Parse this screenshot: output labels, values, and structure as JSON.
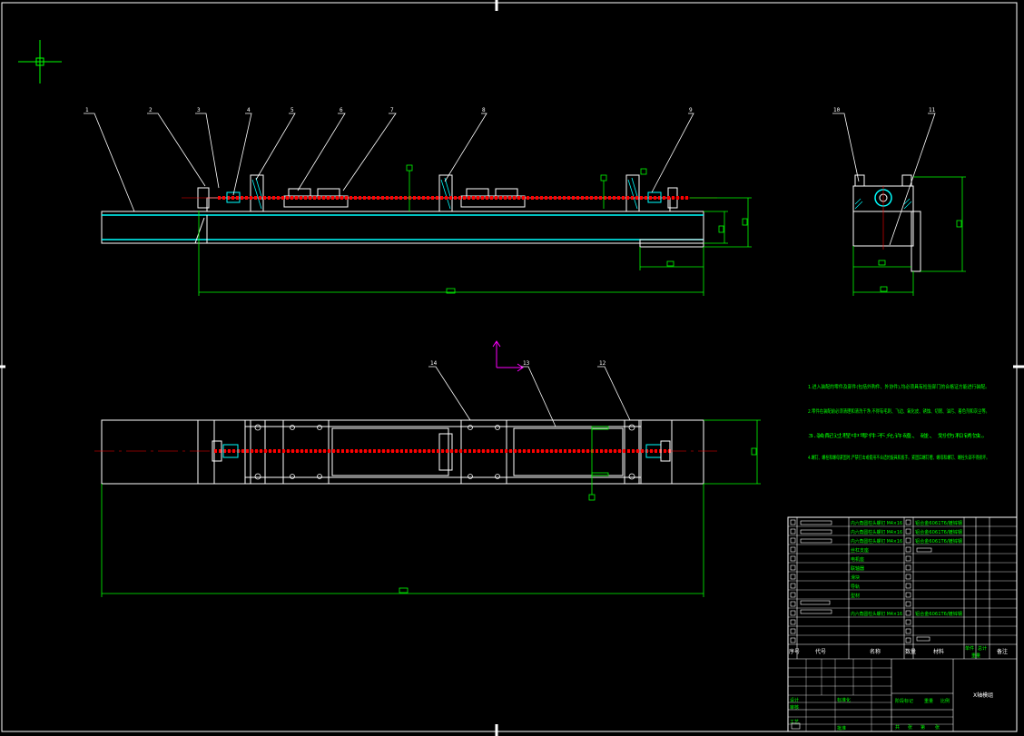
{
  "drawing": {
    "part_callouts": [
      "1",
      "2",
      "3",
      "4",
      "5",
      "6",
      "7",
      "8",
      "9",
      "10",
      "11",
      "12",
      "13",
      "14"
    ],
    "tech_notes": [
      "1.进入装配的零件及部件(包括外购件、外协件),均必须具有检验部门的合格证方能进行装配。",
      "2.零件在装配前必须清理和清洗干净,不得有毛刺、飞边、氧化皮、锈蚀、切屑、油污、着色剂和灰尘等。",
      "3.装配过程中零件不允许磕、碰、划伤和锈蚀。",
      "4.螺钉、螺栓和螺母紧固时,严禁打击或使用不合适的旋具和扳手。紧固后螺钉槽、螺母和螺钉、螺栓头部不得损坏。"
    ],
    "title_block": {
      "drawing_name": "X轴模组",
      "header_seq": "序号",
      "header_code": "代号",
      "header_name": "名称",
      "header_qty": "数量",
      "header_material": "材料",
      "header_weight_single": "单件",
      "header_weight_total": "总计",
      "header_weight": "重量",
      "header_remark": "备注",
      "bom_spec": "内六角圆柱头螺钉 M4×16",
      "bom_material_long": "铝合金6061T6/镀锌钢",
      "bom_names": [
        "丝杠支座",
        "电机座",
        "联轴器",
        "滑块",
        "导轨",
        "型材"
      ],
      "sign_rows": [
        "设计",
        "审核",
        "工艺",
        "标准化",
        "批准"
      ],
      "stage_label": "阶段标记",
      "weight_label": "重量",
      "scale_label": "比例",
      "sheet_labels": [
        "共",
        "张",
        "第",
        "张"
      ]
    }
  },
  "colors": {
    "background": "#000000",
    "outline": "#ffffff",
    "dimension": "#00ff00",
    "centerline": "#ff0000",
    "hatch": "#00ffff",
    "axis_marker": "#ff00ff",
    "callout_text": "#ffffff",
    "notes_text": "#00ff00"
  }
}
